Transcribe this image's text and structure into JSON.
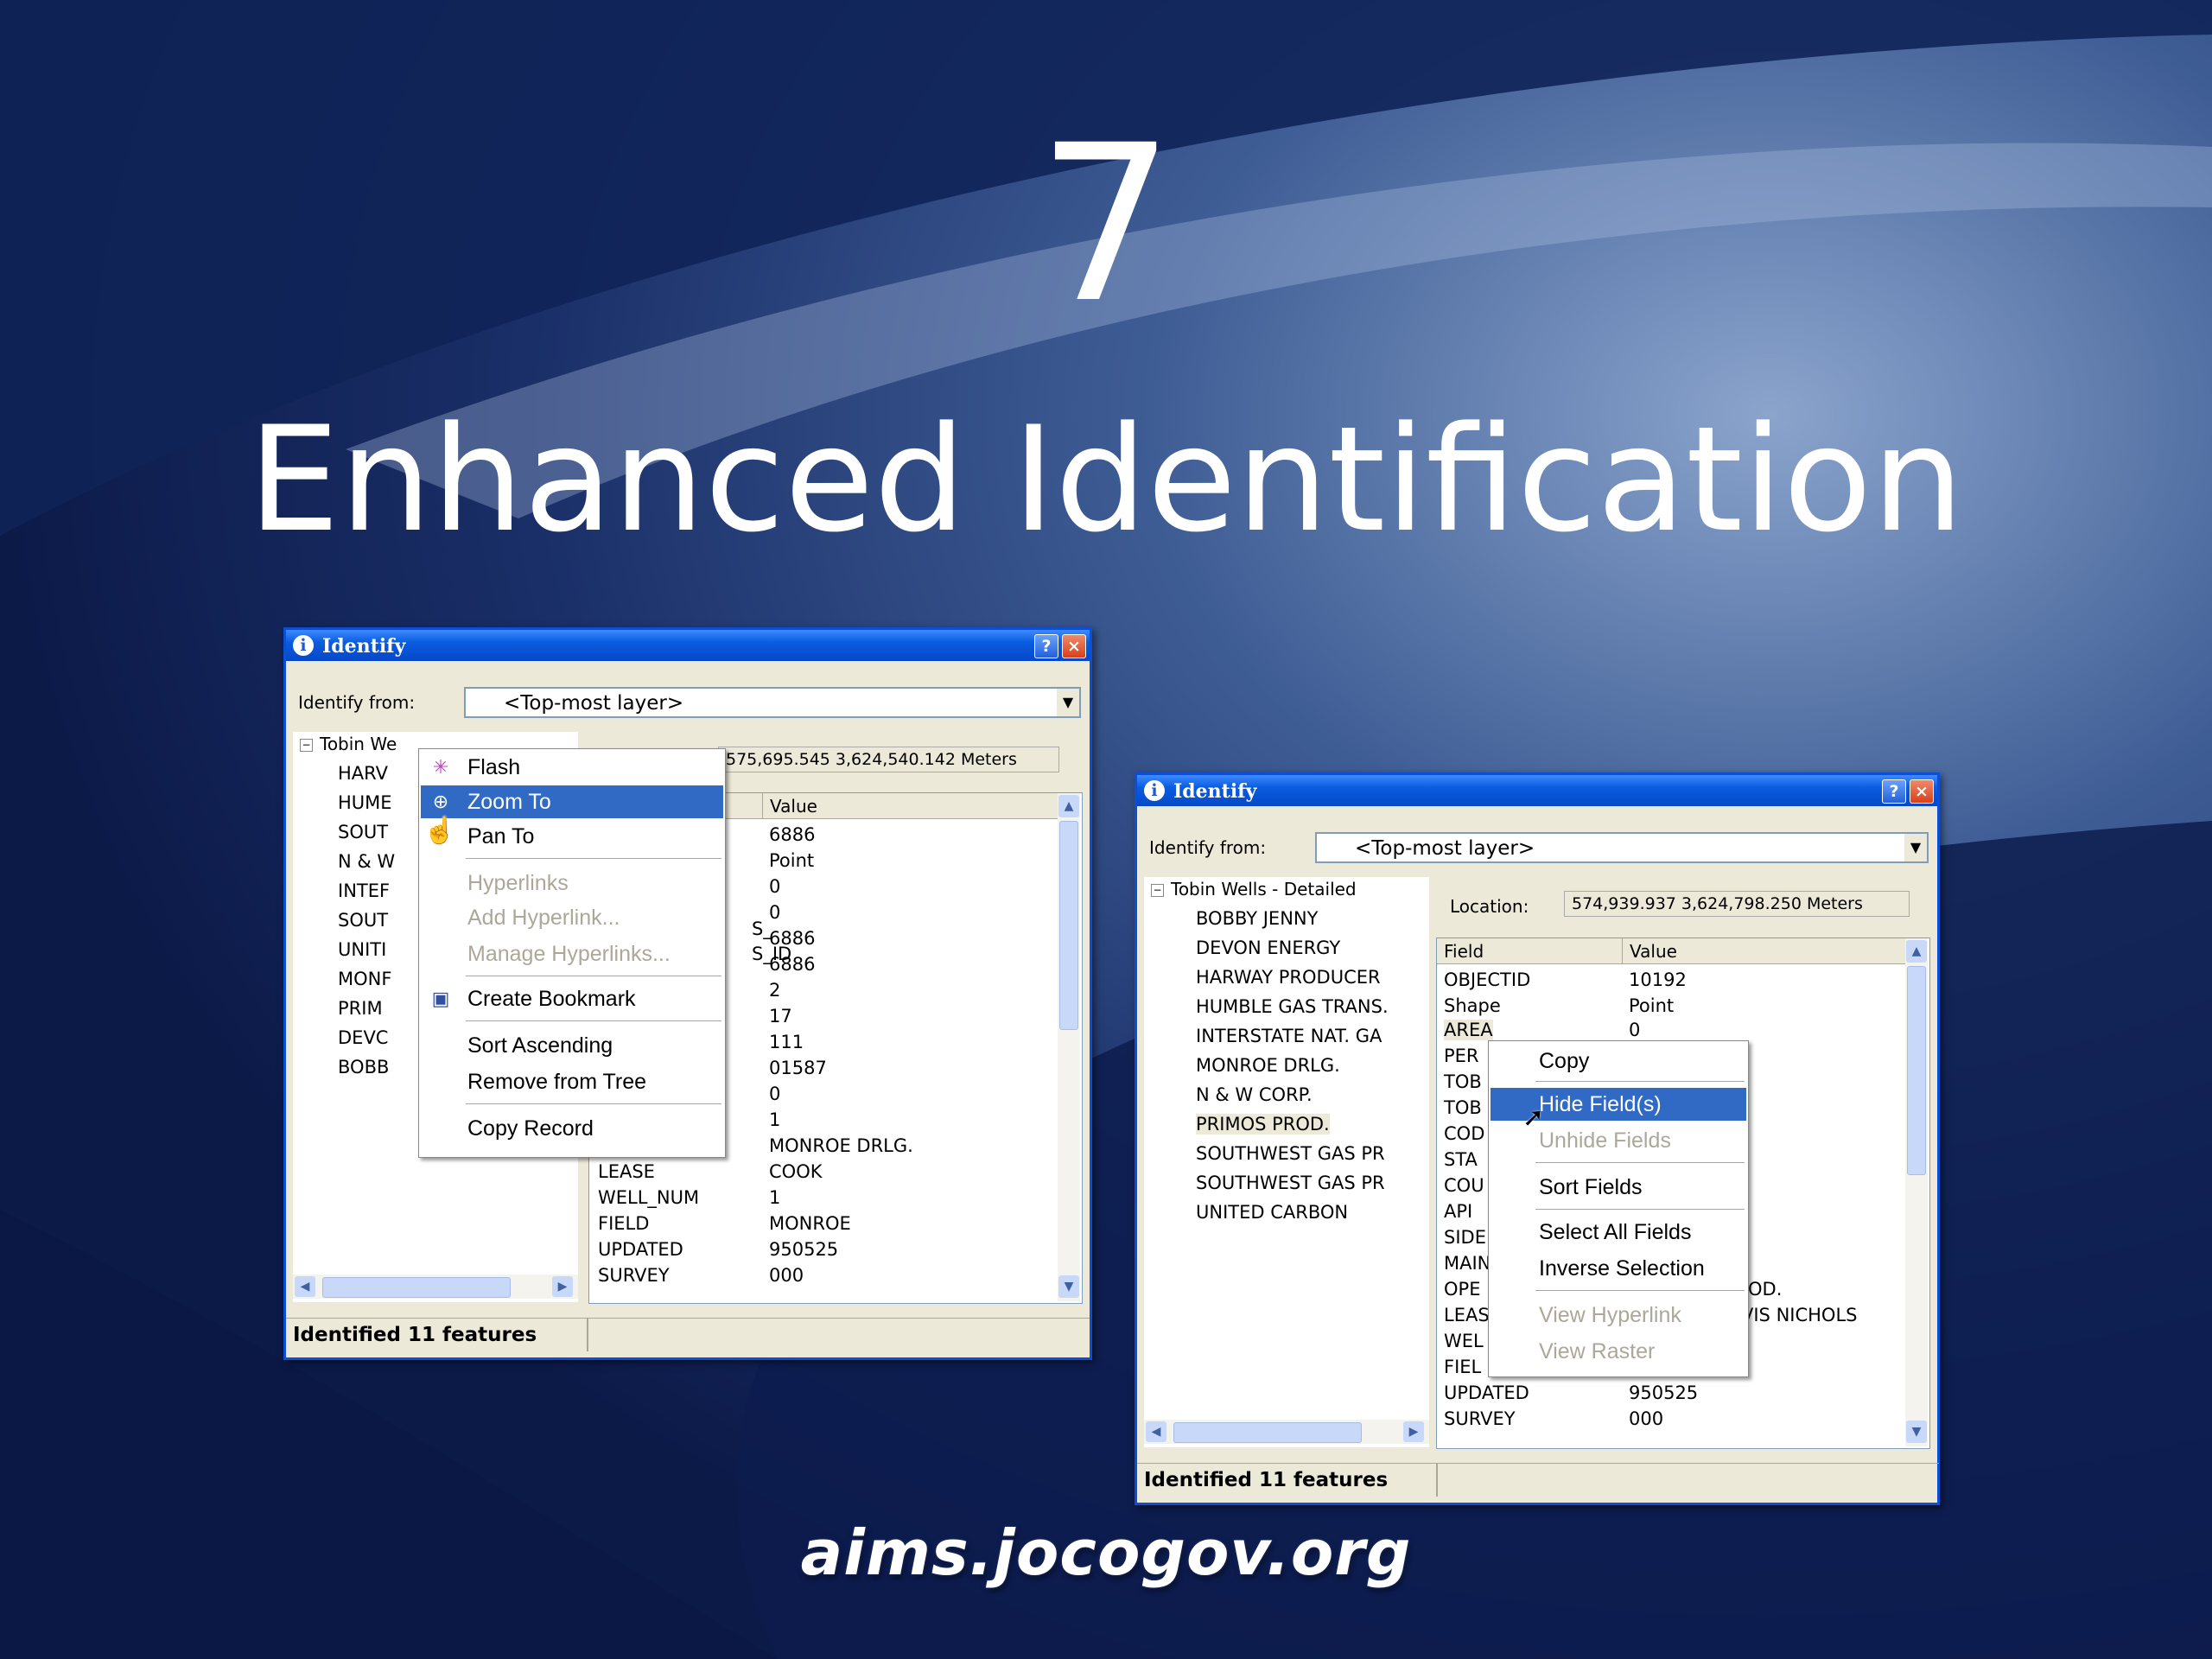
{
  "slide": {
    "number": "7",
    "title": "Enhanced Identification",
    "footer_url": "aims.jocogov.org"
  },
  "window_left": {
    "title": "Identify",
    "identify_from_label": "Identify from:",
    "identify_from_value": "<Top-most layer>",
    "tree_root": "Tobin We",
    "tree_items": [
      "HARV",
      "HUME",
      "SOUT",
      "N & W",
      "INTEF",
      "SOUT",
      "UNITI",
      "MONF",
      "PRIM",
      "DEVC",
      "BOBB"
    ],
    "location_value": "575,695.545  3,624,540.142 Meters",
    "value_header": "Value",
    "fields_partial": [
      "S_",
      "S_ID"
    ],
    "values": [
      "6886",
      "Point",
      "0",
      "0",
      "6886",
      "6886",
      "2",
      "17",
      "111",
      "01587",
      "0",
      "1",
      "MONROE DRLG.",
      "COOK",
      "1",
      "MONROE",
      "950525",
      "000"
    ],
    "bottom_rows": [
      {
        "field": "LEASE",
        "value": "COOK"
      },
      {
        "field": "WELL_NUM",
        "value": "1"
      },
      {
        "field": "FIELD",
        "value": "MONROE"
      },
      {
        "field": "UPDATED",
        "value": "950525"
      },
      {
        "field": "SURVEY",
        "value": "000"
      }
    ],
    "status": "Identified 11 features",
    "context_menu": {
      "flash": "Flash",
      "zoom_to": "Zoom To",
      "pan_to": "Pan To",
      "hyperlinks": "Hyperlinks",
      "add_hyperlink": "Add Hyperlink...",
      "manage_hyperlinks": "Manage Hyperlinks...",
      "create_bookmark": "Create Bookmark",
      "sort_ascending": "Sort Ascending",
      "remove_from_tree": "Remove from Tree",
      "copy_record": "Copy Record"
    }
  },
  "window_right": {
    "title": "Identify",
    "identify_from_label": "Identify from:",
    "identify_from_value": "<Top-most layer>",
    "tree_root": "Tobin Wells - Detailed",
    "tree_items": [
      "BOBBY JENNY",
      "DEVON ENERGY",
      "HARWAY PRODUCER",
      "HUMBLE GAS TRANS.",
      "INTERSTATE NAT. GA",
      "MONROE DRLG.",
      "N & W CORP.",
      "PRIMOS PROD.",
      "SOUTHWEST GAS PR",
      "SOUTHWEST GAS PR",
      "UNITED CARBON"
    ],
    "location_label": "Location:",
    "location_value": "574,939.937  3,624,798.250 Meters",
    "field_header": "Field",
    "value_header": "Value",
    "rows": [
      {
        "field": "OBJECTID",
        "value": "10192"
      },
      {
        "field": "Shape",
        "value": "Point"
      },
      {
        "field": "AREA",
        "value": "0"
      },
      {
        "field": "PER",
        "value": ""
      },
      {
        "field": "TOB",
        "value": ""
      },
      {
        "field": "TOB",
        "value": ""
      },
      {
        "field": "COD",
        "value": ""
      },
      {
        "field": "STA",
        "value": ""
      },
      {
        "field": "COU",
        "value": ""
      },
      {
        "field": "API",
        "value": ""
      },
      {
        "field": "SIDE",
        "value": ""
      },
      {
        "field": "MAIN",
        "value": ""
      },
      {
        "field": "OPE",
        "value": "OD."
      },
      {
        "field": "LEAS",
        "value": "VIS NICHOLS"
      },
      {
        "field": "WEL",
        "value": ""
      },
      {
        "field": "FIEL",
        "value": ""
      },
      {
        "field": "UPDATED",
        "value": "950525"
      },
      {
        "field": "SURVEY",
        "value": "000"
      }
    ],
    "status": "Identified 11 features",
    "context_menu": {
      "copy": "Copy",
      "hide_fields": "Hide Field(s)",
      "unhide_fields": "Unhide Fields",
      "sort_fields": "Sort Fields",
      "select_all_fields": "Select All Fields",
      "inverse_selection": "Inverse Selection",
      "view_hyperlink": "View Hyperlink",
      "view_raster": "View Raster"
    }
  }
}
